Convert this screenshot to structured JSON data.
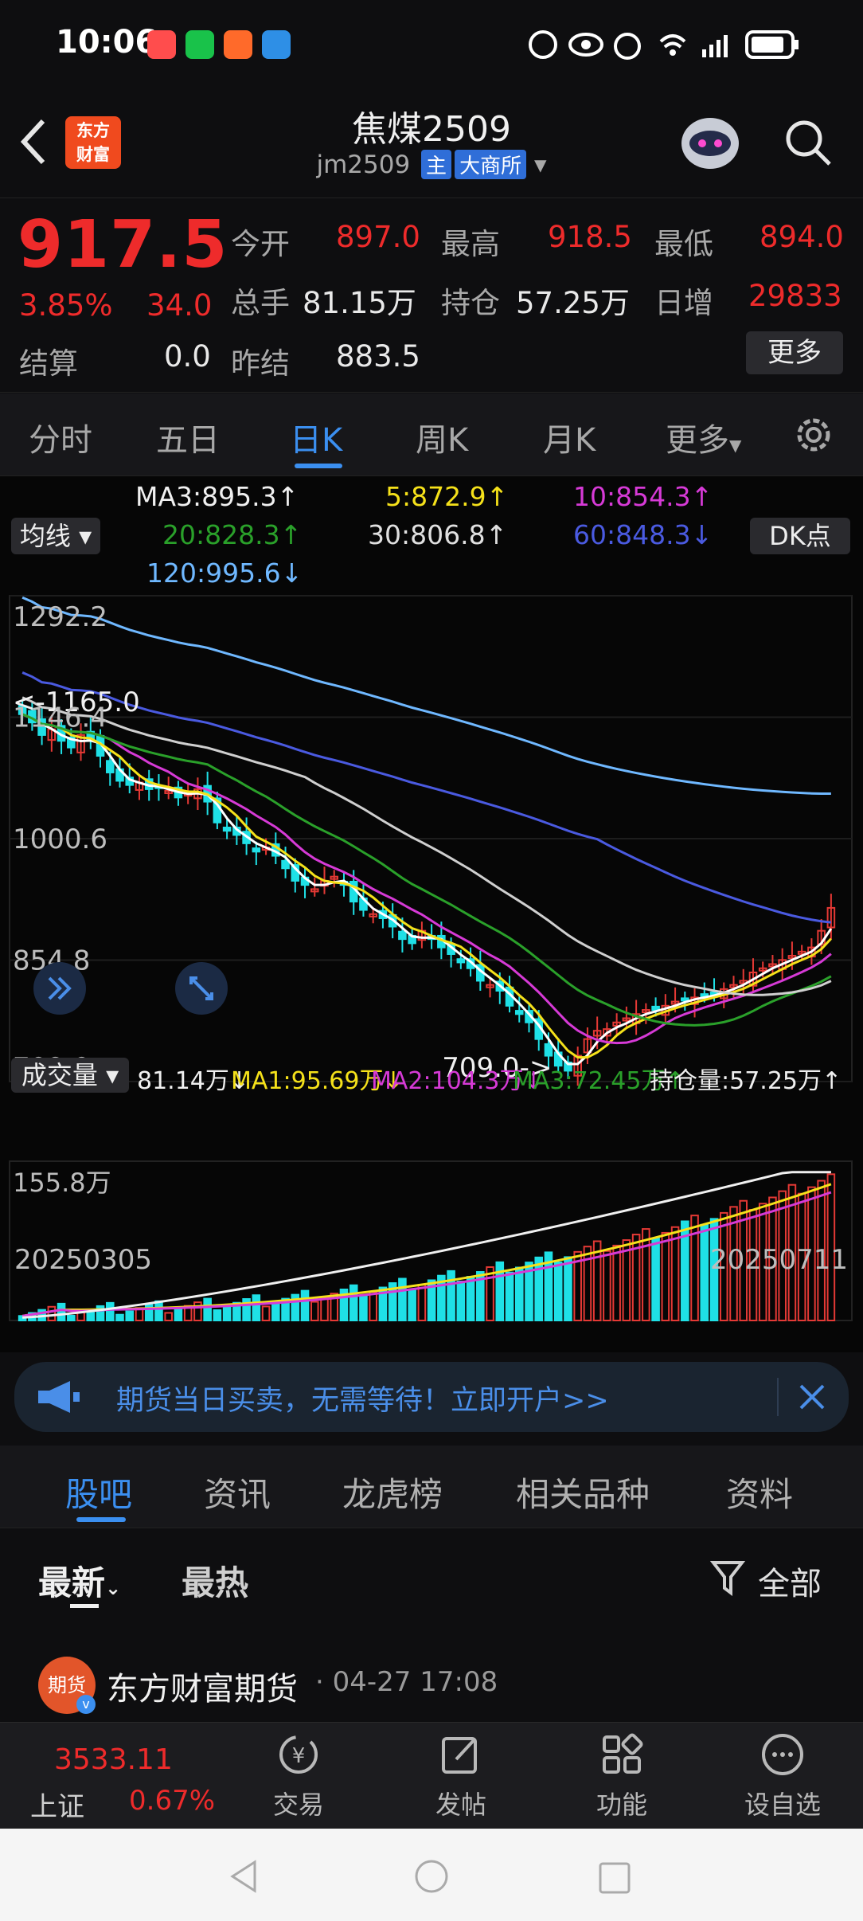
{
  "status_bar": {
    "time": "10:06"
  },
  "header": {
    "back": "‹",
    "logo_line1": "东方",
    "logo_line2": "财富",
    "title": "焦煤2509",
    "code": "jm2509",
    "tag_main": "主",
    "tag_exchange": "大商所"
  },
  "quote": {
    "price": "917.5",
    "change_pct": "3.85%",
    "change": "34.0",
    "open_label": "今开",
    "open": "897.0",
    "high_label": "最高",
    "high": "918.5",
    "low_label": "最低",
    "low": "894.0",
    "volume_label": "总手",
    "volume": "81.15万",
    "oi_label": "持仓",
    "oi": "57.25万",
    "oi_inc_label": "日增",
    "oi_inc": "29833",
    "settle_label": "结算",
    "settle": "0.0",
    "prev_settle_label": "昨结",
    "prev_settle": "883.5",
    "more": "更多"
  },
  "period_tabs": [
    "分时",
    "五日",
    "日K",
    "周K",
    "月K",
    "更多"
  ],
  "active_period": "日K",
  "ma_panel": {
    "selector": "均线",
    "dk": "DK点",
    "ma3": "MA3:895.3↑",
    "ma5": "5:872.9↑",
    "ma10": "10:854.3↑",
    "ma20": "20:828.3↑",
    "ma30": "30:806.8↑",
    "ma60": "60:848.3↓",
    "ma120": "120:995.6↓"
  },
  "chart_data": {
    "type": "candlestick",
    "price_ticks": [
      "1292.2",
      "1146.4",
      "1000.6",
      "854.8",
      "709.0"
    ],
    "annotation_high": "<-1165.0",
    "annotation_low": "709.0->",
    "ylim": [
      709.0,
      1292.2
    ],
    "candles_count": 84,
    "closes": [
      1150,
      1140,
      1125,
      1132,
      1118,
      1110,
      1125,
      1120,
      1100,
      1080,
      1070,
      1065,
      1068,
      1060,
      1062,
      1058,
      1050,
      1055,
      1060,
      1045,
      1020,
      1010,
      1005,
      995,
      985,
      990,
      980,
      965,
      950,
      945,
      940,
      950,
      955,
      945,
      925,
      915,
      910,
      905,
      895,
      880,
      875,
      890,
      880,
      870,
      862,
      852,
      845,
      830,
      825,
      818,
      800,
      790,
      780,
      760,
      740,
      728,
      722,
      740,
      760,
      770,
      772,
      780,
      785,
      790,
      795,
      795,
      800,
      805,
      808,
      810,
      812,
      815,
      820,
      825,
      830,
      840,
      845,
      850,
      855,
      860,
      865,
      870,
      890,
      917.5
    ],
    "volume_ticks": [
      "155.8万"
    ],
    "volume_legend": {
      "selector": "成交量",
      "vol": "81.14万↓",
      "ma1": "MA1:95.69万↓",
      "ma2": "MA2:104.3万↓",
      "ma3": "MA3:72.45万↑",
      "oi": "持仓量:57.25万↑"
    },
    "date_start": "20250305",
    "date_end": "20250711",
    "colors": {
      "up": "#e53935",
      "down": "#1fe0e6",
      "ma3": "#ffffff",
      "ma5": "#f5e11a",
      "ma10": "#d63ad6",
      "ma20": "#2aa02a",
      "ma30": "#cfcfcf",
      "ma60": "#4a5ae0",
      "ma120": "#6fb8ff"
    }
  },
  "banner": {
    "text": "期货当日买卖，无需等待！立即开户>>"
  },
  "sub_tabs": [
    "股吧",
    "资讯",
    "龙虎榜",
    "相关品种",
    "资料"
  ],
  "filters": {
    "latest": "最新",
    "hot": "最热",
    "all": "全部"
  },
  "post": {
    "author": "东方财富期货",
    "time": "· 04-27 17:08",
    "avatar_text": "期货"
  },
  "bottom_nav": {
    "index_value": "3533.11",
    "index_name": "上证",
    "index_change": "0.67%",
    "items": [
      "交易",
      "发帖",
      "功能",
      "设自选"
    ]
  }
}
